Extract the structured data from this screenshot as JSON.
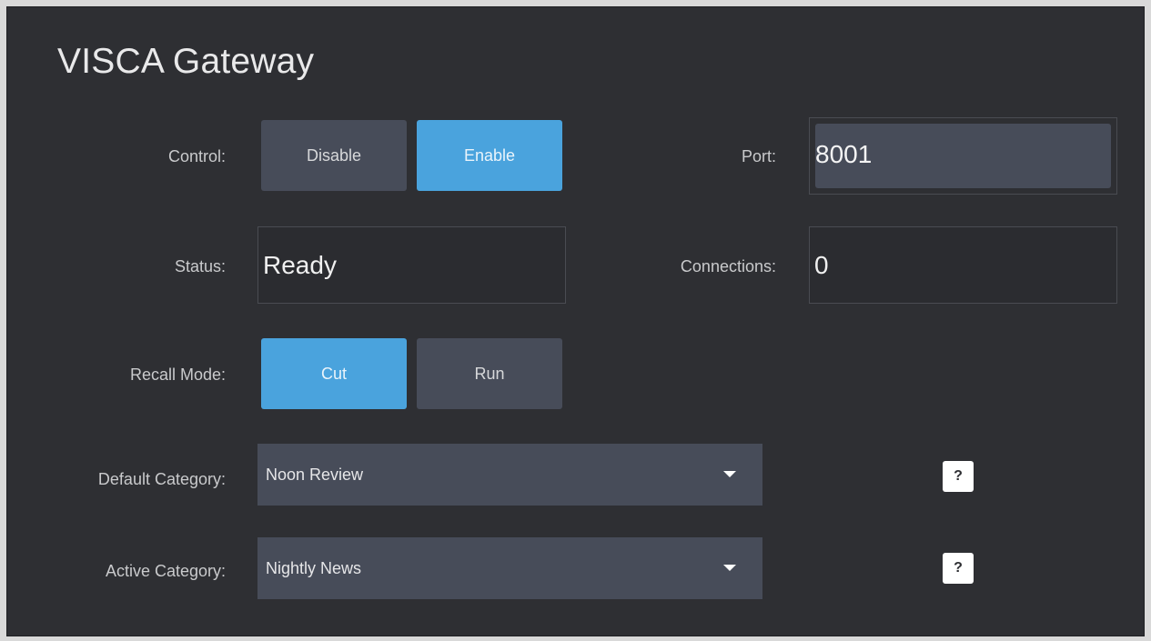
{
  "panel": {
    "title": "VISCA Gateway"
  },
  "control": {
    "label": "Control:",
    "options": [
      "Disable",
      "Enable"
    ],
    "selected": "Enable"
  },
  "port": {
    "label": "Port:",
    "value": "8001"
  },
  "status": {
    "label": "Status:",
    "value": "Ready"
  },
  "connections": {
    "label": "Connections:",
    "value": "0"
  },
  "recall_mode": {
    "label": "Recall Mode:",
    "options": [
      "Cut",
      "Run"
    ],
    "selected": "Cut"
  },
  "default_category": {
    "label": "Default Category:",
    "value": "Noon Review",
    "help": "?"
  },
  "active_category": {
    "label": "Active Category:",
    "value": "Nightly News",
    "help": "?"
  },
  "colors": {
    "panel_bg": "#2e2f33",
    "button_bg": "#474c59",
    "accent": "#4aa3dd"
  }
}
